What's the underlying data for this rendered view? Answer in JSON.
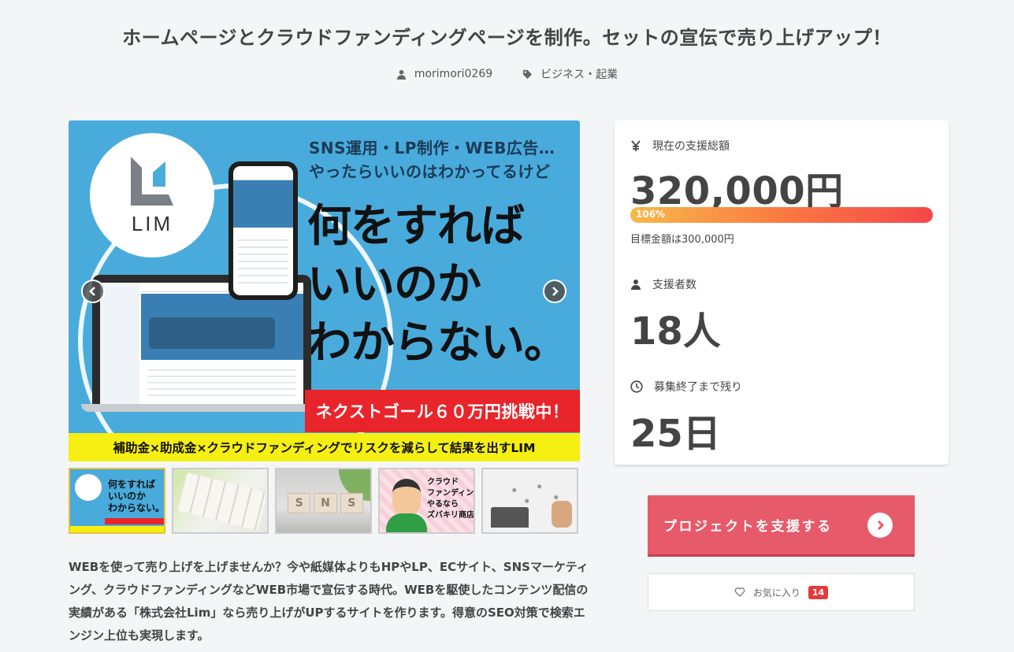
{
  "project": {
    "title": "ホームページとクラウドファンディングページを制作。セットの宣伝で売り上げアップ！",
    "author": "morimori0269",
    "category": "ビジネス・起業",
    "description": "WEBを使って売り上げを上げませんか？今や紙媒体よりもHPやLP、ECサイト、SNSマーケティング、クラウドファンディングなどWEB市場で宣伝する時代。WEBを駆使したコンテンツ配信の実績がある「株式会社Lim」なら売り上げがUPするサイトを作ります。得意のSEO対策で検索エンジン上位も実現します。"
  },
  "hero": {
    "logo_text": "LIM",
    "copy_top_1": "SNS運用・LP制作・WEB広告…",
    "copy_top_2": "やったらいいのはわかってるけど",
    "copy_big_1": "何をすれば",
    "copy_big_2": "いいのか",
    "copy_big_3": "わからない。",
    "red_band": "ネクストゴール６０万円挑戦中！",
    "yellow_band": "補助金×助成金×クラウドファンディングでリスクを減らして結果を出すLIM"
  },
  "thumbs": {
    "t1_text": "何をすれば\nいいのか\nわからない。",
    "t3_letters": [
      "S",
      "N",
      "S"
    ],
    "t4_text": "クラウド\nファンディング\nやるなら\nズバキリ商店"
  },
  "stats": {
    "amount_label": "現在の支援総額",
    "amount": "320,000円",
    "progress_percent": "106%",
    "progress_value": 1.06,
    "goal": "目標金額は300,000円",
    "backers_label": "支援者数",
    "backers": "18人",
    "days_label": "募集終了まで残り",
    "days": "25日"
  },
  "actions": {
    "support_label": "プロジェクトを支援する",
    "favorite_label": "お気に入り",
    "favorite_count": "14"
  },
  "colors": {
    "accent": "#e75a6a",
    "hero_bg": "#49abdc",
    "badge": "#e03c3c"
  },
  "icons": {
    "author": "user-icon",
    "category": "tag-icon",
    "amount": "yen-icon",
    "backers": "user-icon",
    "days": "clock-icon",
    "favorite": "heart-icon",
    "support": "chevron-right-circle-icon"
  }
}
